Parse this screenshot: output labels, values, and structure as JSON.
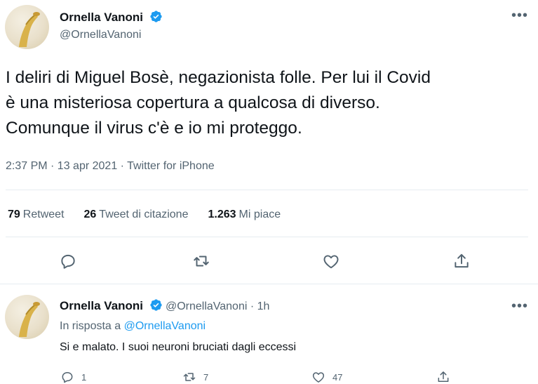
{
  "tweet": {
    "author_name": "Ornella Vanoni",
    "author_handle": "@OrnellaVanoni",
    "verified": true,
    "text_lines": [
      "I deliri di Miguel Bosè, negazionista folle. Per lui il Covid",
      "è una misteriosa copertura a qualcosa di diverso.",
      "Comunque il virus c'è e io mi proteggo."
    ],
    "meta": "2:37 PM · 13 apr 2021 · Twitter for iPhone",
    "stats": {
      "retweets_count": "79",
      "retweets_label": "Retweet",
      "quotes_count": "26",
      "quotes_label": "Tweet di citazione",
      "likes_count": "1.263",
      "likes_label": "Mi piace"
    },
    "more_icon": "more-horizontal-icon",
    "action_icons": [
      "reply-icon",
      "retweet-icon",
      "like-icon",
      "share-icon"
    ]
  },
  "reply": {
    "author_name": "Ornella Vanoni",
    "author_handle": "@OrnellaVanoni",
    "time": "· 1h",
    "reply_prefix": "In risposta a",
    "reply_target": "@OrnellaVanoni",
    "text": "Si e malato. I suoi neuroni bruciati dagli eccessi",
    "counts": {
      "replies": "1",
      "retweets": "7",
      "likes": "47"
    }
  },
  "colors": {
    "accent": "#1d9bf0",
    "secondary_text": "#536471",
    "divider": "#e6ecf0"
  }
}
